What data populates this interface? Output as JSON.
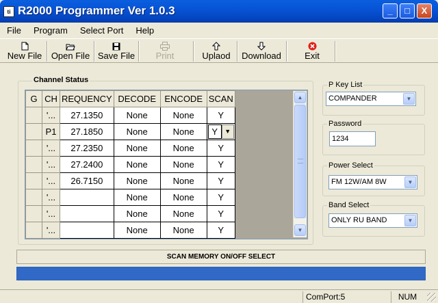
{
  "window": {
    "app_icon": "ti",
    "title": "R2000 Programmer Ver 1.0.3",
    "minimize_glyph": "_",
    "maximize_glyph": "□",
    "close_glyph": "X"
  },
  "menu": [
    "File",
    "Program",
    "Select Port",
    "Help"
  ],
  "toolbar": {
    "new_file": "New File",
    "open_file": "Open File",
    "save_file": "Save File",
    "print": "Print",
    "upload": "Uplaod",
    "download": "Download",
    "exit": "Exit"
  },
  "channel_status": {
    "title": "Channel Status",
    "columns": [
      "G",
      "CH",
      "REQUENCY",
      "DECODE",
      "ENCODE",
      "SCAN"
    ],
    "rows": [
      {
        "g": "",
        "ch": "'...",
        "freq": "27.1350",
        "decode": "None",
        "encode": "None",
        "scan": "Y"
      },
      {
        "g": "",
        "ch": "P1",
        "freq": "27.1850",
        "decode": "None",
        "encode": "None",
        "scan": "Y"
      },
      {
        "g": "",
        "ch": "'...",
        "freq": "27.2350",
        "decode": "None",
        "encode": "None",
        "scan": "Y"
      },
      {
        "g": "",
        "ch": "'...",
        "freq": "27.2400",
        "decode": "None",
        "encode": "None",
        "scan": "Y"
      },
      {
        "g": "",
        "ch": "'...",
        "freq": "26.7150",
        "decode": "None",
        "encode": "None",
        "scan": "Y"
      },
      {
        "g": "",
        "ch": "'...",
        "freq": "",
        "decode": "None",
        "encode": "None",
        "scan": "Y"
      },
      {
        "g": "",
        "ch": "'...",
        "freq": "",
        "decode": "None",
        "encode": "None",
        "scan": "Y"
      },
      {
        "g": "",
        "ch": "'...",
        "freq": "",
        "decode": "None",
        "encode": "None",
        "scan": "Y"
      }
    ],
    "active_cell_value": "Y"
  },
  "pkey": {
    "label": "P Key List",
    "value": "COMPANDER"
  },
  "password": {
    "label": "Password",
    "value": "1234"
  },
  "power": {
    "label": "Power Select",
    "value": "FM 12W/AM 8W"
  },
  "band": {
    "label": "Band Select",
    "value": "ONLY RU BAND"
  },
  "status_message": "SCAN MEMORY ON/OFF SELECT",
  "progress": 1.0,
  "statusbar": {
    "comport": "ComPort:5",
    "num": "NUM"
  },
  "colors": {
    "titlebar": "#0854d6",
    "progress": "#3169c6",
    "window": "#ece9d8"
  }
}
